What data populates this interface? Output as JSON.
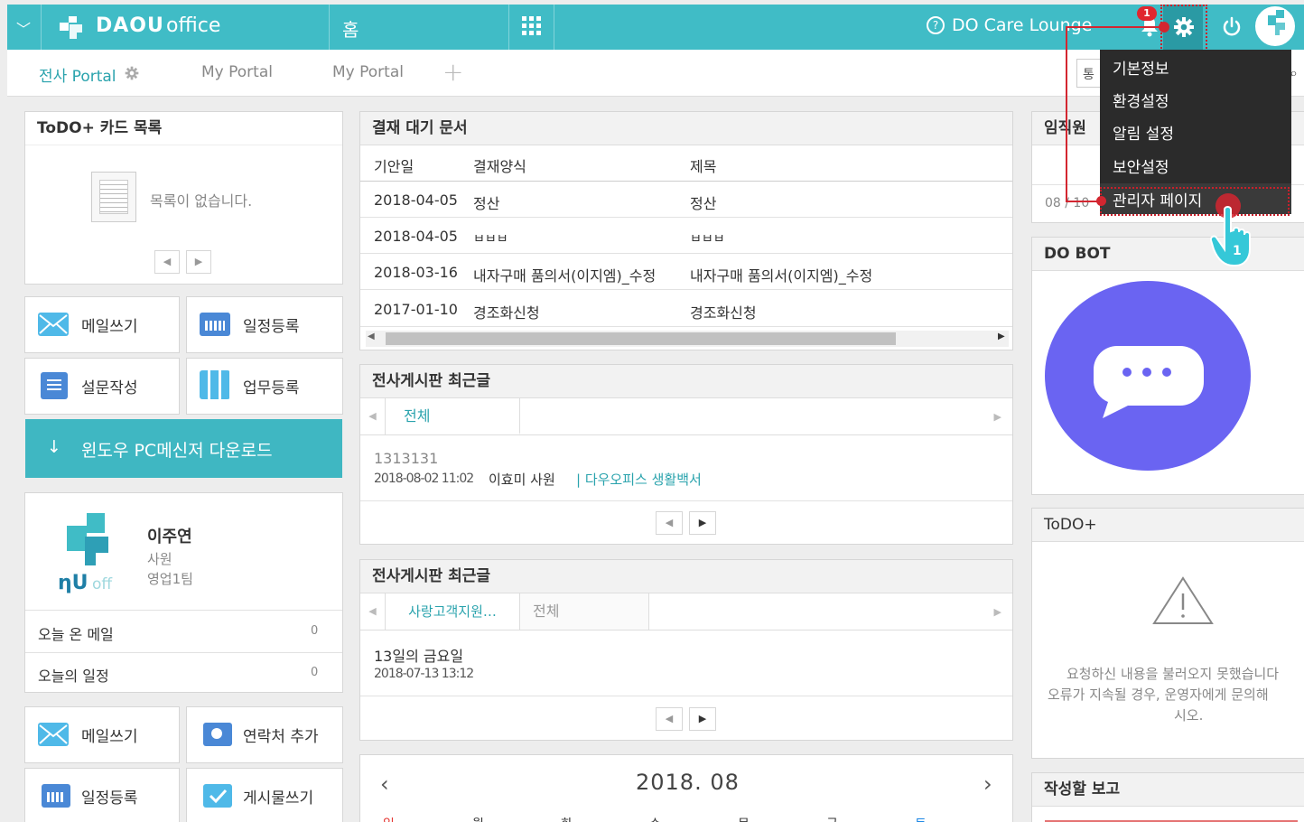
{
  "header": {
    "logo_text": "DAOU",
    "logo_suffix": "office",
    "home_label": "홈",
    "care_lounge": "DO Care Lounge",
    "notification_count": "1",
    "accent_color": "#40bcc6"
  },
  "tabs": [
    {
      "label": "전사 Portal"
    },
    {
      "label": "My Portal"
    },
    {
      "label": "My Portal"
    }
  ],
  "tab_add": "+",
  "search_partial": "통",
  "settings_menu": {
    "items": [
      "기본정보",
      "환경설정",
      "알림 설정",
      "보안설정",
      "관리자 페이지"
    ],
    "callout_number": "1"
  },
  "todo_card": {
    "title": "ToDO+ 카드 목록",
    "empty_text": "목록이 없습니다."
  },
  "quick_actions_top": [
    "메일쓰기",
    "일정등록",
    "설문작성",
    "업무등록"
  ],
  "download_banner": "윈도우 PC메신저 다운로드",
  "profile": {
    "name": "이주연",
    "position": "사원",
    "team": "영업1팀",
    "stats": [
      {
        "label": "오늘 온 메일",
        "value": "0"
      },
      {
        "label": "오늘의 일정",
        "value": "0"
      }
    ]
  },
  "quick_actions_bottom": [
    "메일쓰기",
    "연락처 추가",
    "일정등록",
    "게시물쓰기"
  ],
  "approval": {
    "title": "결재 대기 문서",
    "columns": [
      "기안일",
      "결재양식",
      "제목"
    ],
    "rows": [
      {
        "date": "2018-04-05",
        "form": "정산",
        "subject": "정산"
      },
      {
        "date": "2018-04-05",
        "form": "ㅂㅂㅂ",
        "subject": "ㅂㅂㅂ"
      },
      {
        "date": "2018-03-16",
        "form": "내자구매 품의서(이지엠)_수정",
        "subject": "내자구매 품의서(이지엠)_수정"
      },
      {
        "date": "2017-01-10",
        "form": "경조화신청",
        "subject": "경조화신청"
      }
    ]
  },
  "board1": {
    "title": "전사게시판 최근글",
    "tab": "전체",
    "post_title": "1313131",
    "post_date": "2018-08-02 11:02",
    "post_author": "이효미 사원",
    "post_board": "다우오피스 생활백서"
  },
  "board2": {
    "title": "전사게시판 최근글",
    "tabs": [
      "사랑고객지원…",
      "전체"
    ],
    "post_title": "13일의 금요일",
    "post_date": "2018-07-13 13:12"
  },
  "calendar": {
    "month": "2018. 08",
    "weekdays": [
      "일",
      "월",
      "화",
      "수",
      "목",
      "금",
      "토"
    ]
  },
  "employees": {
    "title": "임직원",
    "partial_date": "08 / 10"
  },
  "dobot": {
    "title": "DO BOT",
    "color": "#6a64f2"
  },
  "todo_plus": {
    "title": "ToDO+",
    "error_lines": [
      "요청하신 내용을 불러오지 못했습니다",
      "오류가 지속될 경우, 운영자에게 문의해",
      "시오."
    ]
  },
  "report": {
    "title": "작성할 보고"
  }
}
